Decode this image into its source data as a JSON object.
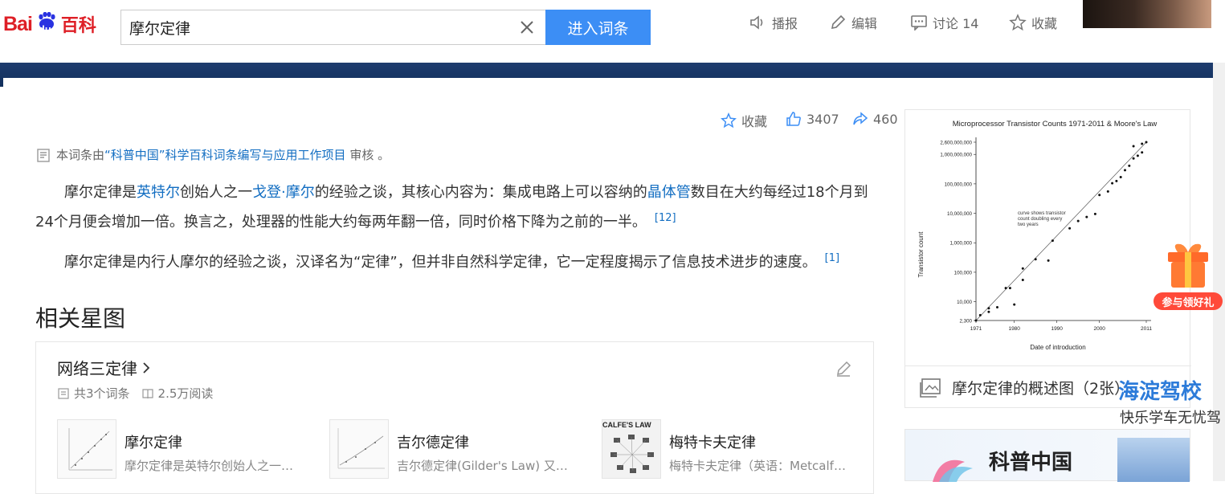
{
  "header": {
    "logo": {
      "bai": "Bai",
      "du": "du",
      "baike": "百科"
    },
    "search_value": "摩尔定律",
    "enter_label": "进入词条",
    "tools": {
      "broadcast": "播报",
      "edit": "编辑",
      "discuss": "讨论 14",
      "collect": "收藏"
    }
  },
  "article": {
    "actions": {
      "collect": "收藏",
      "likes": "3407",
      "shares": "460"
    },
    "review": {
      "prefix": "本词条由",
      "link": "“科普中国”科学百科词条编写与应用工作项目",
      "suffix": " 审核 。"
    },
    "para1": {
      "p1": "摩尔定律是",
      "l1": "英特尔",
      "p2": "创始人之一",
      "l2": "戈登·摩尔",
      "p3": "的经验之谈，其核心内容为：集成电路上可以容纳的",
      "l3": "晶体管",
      "p4": "数目在大约每经过18个月到24个月便会增加一倍。换言之，处理器的性能大约每两年翻一倍，同时价格下降为之前的一半。",
      "ref": "[12]"
    },
    "para2": {
      "text": "摩尔定律是内行人摩尔的经验之谈，汉译名为“定律”，但并非自然科学定律，它一定程度揭示了信息技术进步的速度。",
      "ref": "[1]"
    },
    "section_title": "相关星图"
  },
  "star_map": {
    "title": "网络三定律",
    "entries_count": "共3个词条",
    "reads": "2.5万阅读",
    "entries": [
      {
        "name": "摩尔定律",
        "desc": "摩尔定律是英特尔创始人之一…"
      },
      {
        "name": "吉尔德定律",
        "desc": "吉尔德定律(Gilder's Law) 又…"
      },
      {
        "name": "梅特卡夫定律",
        "desc": "梅特卡夫定律（英语：Metcalf…",
        "thumb_label": "CALFE'S LAW"
      }
    ]
  },
  "figure": {
    "caption": "摩尔定律的概述图（2张）",
    "chart_data": {
      "type": "scatter",
      "title": "Microprocessor Transistor Counts 1971-2011 & Moore's Law",
      "xlabel": "Date of introduction",
      "ylabel": "Transistor count",
      "x_ticks": [
        "1971",
        "1980",
        "1990",
        "2000",
        "2011"
      ],
      "y_ticks": [
        "2,300",
        "10,000",
        "100,000",
        "1,000,000",
        "10,000,000",
        "100,000,000",
        "1,000,000,000",
        "2,600,000,000"
      ],
      "xlim": [
        1971,
        2011
      ],
      "ylim": [
        2300,
        2600000000
      ],
      "log_scale_y": true,
      "annotation": "curve shows transistor count doubling every two years",
      "points": [
        {
          "x": 1971,
          "y": 2300
        },
        {
          "x": 1972,
          "y": 3500
        },
        {
          "x": 1974,
          "y": 4500
        },
        {
          "x": 1974,
          "y": 6000
        },
        {
          "x": 1976,
          "y": 6500
        },
        {
          "x": 1978,
          "y": 29000
        },
        {
          "x": 1979,
          "y": 29000
        },
        {
          "x": 1980,
          "y": 8000
        },
        {
          "x": 1982,
          "y": 134000
        },
        {
          "x": 1982,
          "y": 55000
        },
        {
          "x": 1985,
          "y": 275000
        },
        {
          "x": 1988,
          "y": 250000
        },
        {
          "x": 1989,
          "y": 1180000
        },
        {
          "x": 1993,
          "y": 3100000
        },
        {
          "x": 1995,
          "y": 5500000
        },
        {
          "x": 1997,
          "y": 7500000
        },
        {
          "x": 1999,
          "y": 9500000
        },
        {
          "x": 2000,
          "y": 42000000
        },
        {
          "x": 2002,
          "y": 55000000
        },
        {
          "x": 2003,
          "y": 105000000
        },
        {
          "x": 2004,
          "y": 125000000
        },
        {
          "x": 2005,
          "y": 169000000
        },
        {
          "x": 2006,
          "y": 291000000
        },
        {
          "x": 2007,
          "y": 410000000
        },
        {
          "x": 2008,
          "y": 731000000
        },
        {
          "x": 2009,
          "y": 904000000
        },
        {
          "x": 2010,
          "y": 1170000000
        },
        {
          "x": 2011,
          "y": 2600000000
        },
        {
          "x": 2010,
          "y": 2300000000
        },
        {
          "x": 2008,
          "y": 1900000000
        }
      ],
      "trend": [
        {
          "x": 1971,
          "y": 2300
        },
        {
          "x": 2011,
          "y": 2600000000
        }
      ]
    }
  },
  "sidebar_ads": {
    "brand": "科普中国",
    "ad_title": "海淀驾校",
    "ad_subtitle": "快乐学车无忧驾",
    "gift_label": "参与领好礼"
  },
  "colors": {
    "accent": "#3c8ef5",
    "link": "#136ec2",
    "logo_red": "#de1f26",
    "band": "#1e3c6e"
  }
}
